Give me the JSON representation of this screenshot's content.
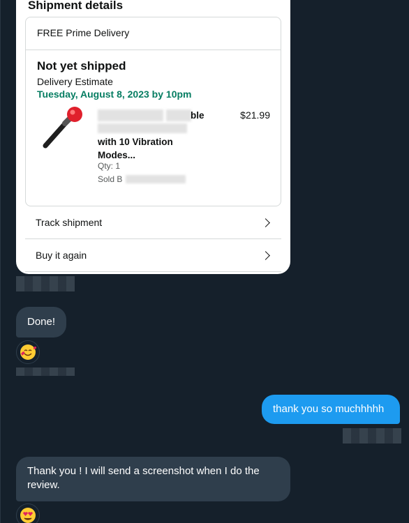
{
  "card": {
    "title": "Shipment details",
    "prime": "FREE Prime Delivery",
    "status": "Not yet shipped",
    "estimate_label": "Delivery Estimate",
    "estimate_date": "Tuesday, August 8, 2023 by 10pm",
    "product": {
      "title_visible_fragment": "ble",
      "title_line2": "with 10 Vibration",
      "title_line3": "Modes...",
      "price": "$21.99",
      "qty": "Qty: 1",
      "sold_by": "Sold B"
    },
    "track_label": "Track shipment",
    "buy_again_label": "Buy it again"
  },
  "messages": [
    {
      "sender": "them",
      "text": "Done!",
      "reaction": "smiling-face-with-hearts"
    },
    {
      "sender": "me",
      "text": "thank you so muchhhhh"
    },
    {
      "sender": "them",
      "text": "Thank you !  I will send a screenshot when I do the review.",
      "reaction": "heart-eyes"
    }
  ],
  "colors": {
    "background": "#15202b",
    "incoming_bubble": "#2f3e4c",
    "outgoing_bubble": "#1d9bf0",
    "delivery_green": "#067d62"
  }
}
